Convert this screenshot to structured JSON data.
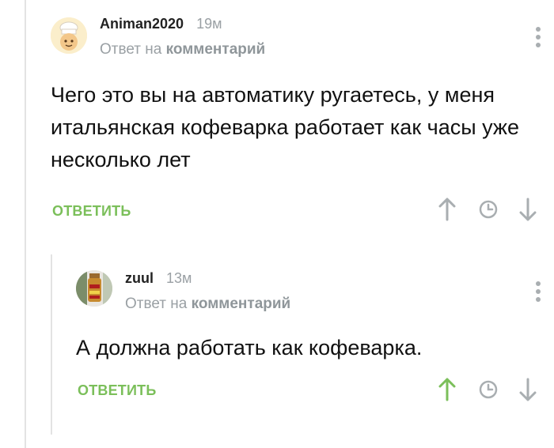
{
  "comments": [
    {
      "username": "Animan2020",
      "time": "19м",
      "reply_prefix": "Ответ на",
      "reply_target": "комментарий",
      "text": "Чего это вы на автоматику ругаетесь, у меня итальянская кофеварка работает как часы уже несколько лет",
      "reply_label": "ОТВЕТИТЬ",
      "upvoted": false
    },
    {
      "username": "zuul",
      "time": "13м",
      "reply_prefix": "Ответ на",
      "reply_target": "комментарий",
      "text": "А должна работать как кофеварка.",
      "reply_label": "ОТВЕТИТЬ",
      "upvoted": true
    }
  ],
  "colors": {
    "accent_green": "#7bbf5a",
    "muted_gray": "#9aa0a4",
    "icon_gray": "#a9aeb1"
  },
  "icons": [
    "menu-dots-icon",
    "upvote-arrow-icon",
    "clock-icon",
    "downvote-arrow-icon"
  ]
}
